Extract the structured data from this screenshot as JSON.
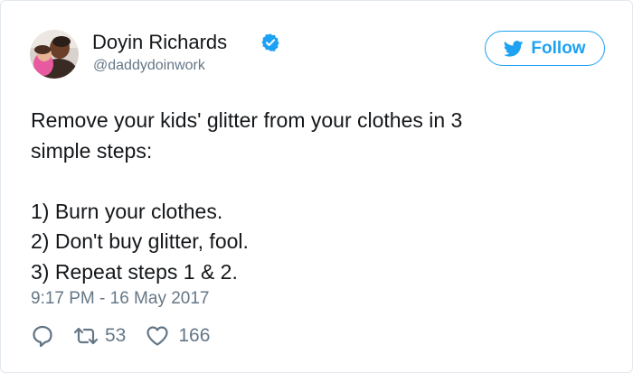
{
  "tweet": {
    "author": {
      "display_name": "Doyin Richards",
      "handle": "@daddydoinwork",
      "verified": true,
      "avatar_icon": "user-avatar-photo"
    },
    "follow_button": {
      "label": "Follow",
      "icon": "twitter-bird-icon"
    },
    "text_lines": [
      "Remove your kids' glitter from your clothes in 3",
      "simple steps:",
      "",
      "1) Burn your clothes.",
      "2) Don't buy glitter, fool.",
      "3) Repeat steps 1 & 2."
    ],
    "timestamp": "9:17 PM - 16 May 2017",
    "actions": {
      "reply": {
        "icon": "reply-bubble-icon"
      },
      "retweet": {
        "icon": "retweet-icon",
        "count": "53"
      },
      "like": {
        "icon": "heart-icon",
        "count": "166"
      }
    }
  },
  "colors": {
    "accent": "#1da1f2",
    "text_primary": "#14171a",
    "text_secondary": "#657786",
    "border": "#e1e8ed"
  }
}
